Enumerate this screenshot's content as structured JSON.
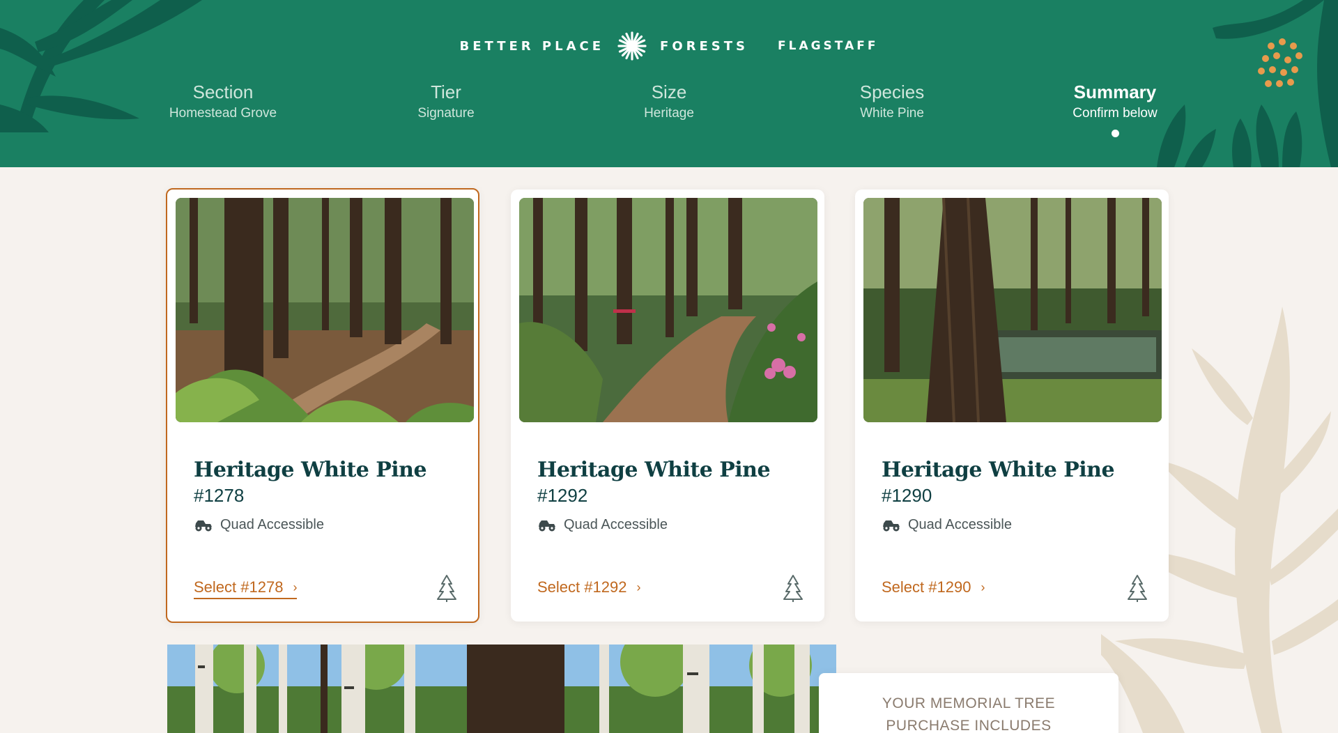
{
  "header": {
    "brand_left": "BETTER PLACE",
    "brand_right": "FORESTS",
    "location": "FLAGSTAFF",
    "colors": {
      "background": "#1a8062",
      "accent_dark": "#0f5f4c",
      "dots": "#e89a4c"
    }
  },
  "steps": [
    {
      "title": "Section",
      "value": "Homestead Grove"
    },
    {
      "title": "Tier",
      "value": "Signature"
    },
    {
      "title": "Size",
      "value": "Heritage"
    },
    {
      "title": "Species",
      "value": "White Pine"
    },
    {
      "title": "Summary",
      "value": "Confirm below",
      "active": true
    }
  ],
  "cards": [
    {
      "title": "Heritage White Pine",
      "number": "#1278",
      "feature": "Quad Accessible",
      "select_label": "Select #1278",
      "selected": true
    },
    {
      "title": "Heritage White Pine",
      "number": "#1292",
      "feature": "Quad Accessible",
      "select_label": "Select #1292",
      "selected": false
    },
    {
      "title": "Heritage White Pine",
      "number": "#1290",
      "feature": "Quad Accessible",
      "select_label": "Select #1290",
      "selected": false
    }
  ],
  "includes": {
    "heading": "YOUR MEMORIAL TREE PURCHASE INCLUDES"
  },
  "icons": {
    "logo": "starburst-icon",
    "feature": "quad-vehicle-icon",
    "tree": "pine-tree-icon",
    "select": "chevron-right-icon"
  },
  "accent_color": "#c0681e"
}
